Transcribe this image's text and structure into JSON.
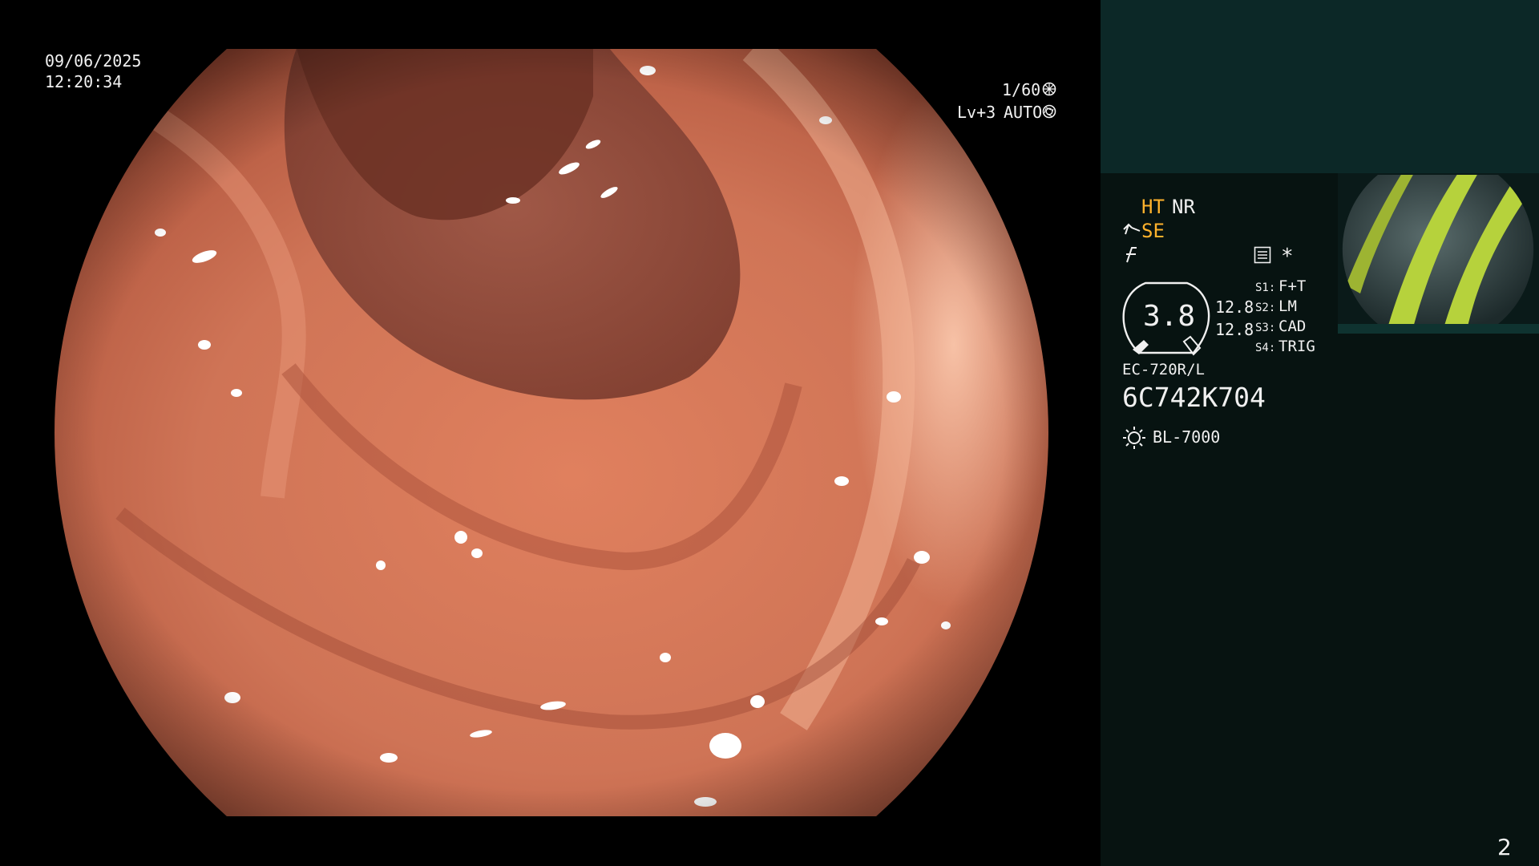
{
  "overlay": {
    "date": "09/06/2025",
    "time": "12:20:34",
    "shutter": "1/60",
    "level": "Lv+3",
    "iris": "AUTO"
  },
  "settings": {
    "ht": "HT",
    "nr": "NR",
    "se": "SE",
    "zoom_value": "3.8",
    "values": [
      "12.8",
      "12.8"
    ],
    "asterisk": "*"
  },
  "switches": [
    {
      "key": "S1:",
      "value": "F+T"
    },
    {
      "key": "S2:",
      "value": "LM"
    },
    {
      "key": "S3:",
      "value": "CAD"
    },
    {
      "key": "S4:",
      "value": "TRIG"
    }
  ],
  "scope_model": "EC-720R/L",
  "scope_serial": "6C742K704",
  "light_source": "BL-7000",
  "page_number": "2",
  "icons": {
    "shutter": "shutter-icon",
    "iris": "iris-icon",
    "settings": "settings-list-icon",
    "light": "light-source-sun-icon"
  },
  "colors": {
    "panel_bg": "#071311",
    "panel_top_bg": "#0c2827",
    "accent_orange": "#ffb22c",
    "thumb_stripe": "#b6d23c"
  }
}
